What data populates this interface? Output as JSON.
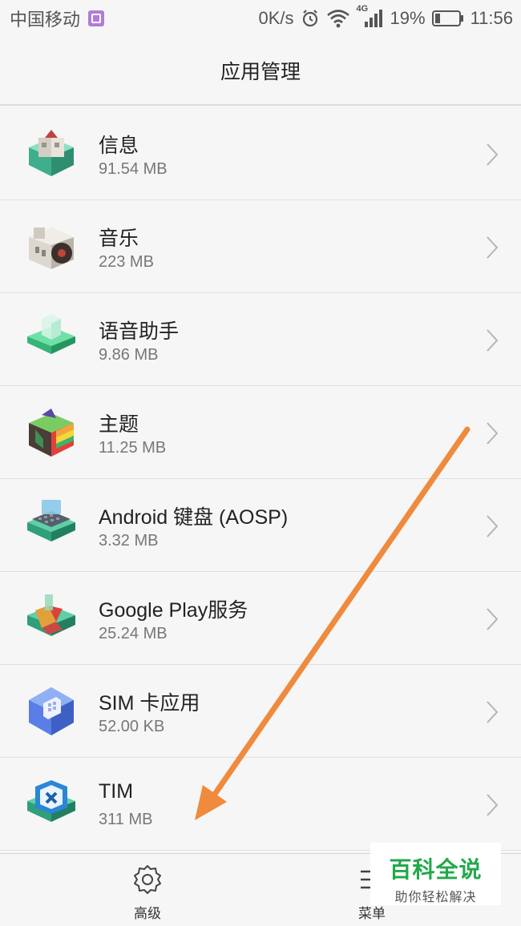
{
  "status_bar": {
    "carrier": "中国移动",
    "speed": "0K/s",
    "network": "4G",
    "battery": "19%",
    "time": "11:56"
  },
  "header": {
    "title": "应用管理"
  },
  "apps": [
    {
      "name": "信息",
      "size": "91.54 MB",
      "icon": "messages-icon"
    },
    {
      "name": "音乐",
      "size": "223 MB",
      "icon": "music-icon"
    },
    {
      "name": "语音助手",
      "size": "9.86 MB",
      "icon": "voice-assistant-icon"
    },
    {
      "name": "主题",
      "size": "11.25 MB",
      "icon": "themes-icon"
    },
    {
      "name": "Android 键盘 (AOSP)",
      "size": "3.32 MB",
      "icon": "keyboard-icon"
    },
    {
      "name": "Google Play服务",
      "size": "25.24 MB",
      "icon": "google-play-services-icon"
    },
    {
      "name": "SIM 卡应用",
      "size": "52.00 KB",
      "icon": "sim-card-icon"
    },
    {
      "name": "TIM",
      "size": "311 MB",
      "icon": "tim-icon"
    }
  ],
  "bottom_bar": {
    "advanced_label": "高级",
    "menu_label": "菜单"
  },
  "watermark": {
    "title": "百科全说",
    "subtitle": "助你轻松解决"
  },
  "colors": {
    "annotation_arrow": "#f08a3c",
    "watermark_green": "#22a84a"
  }
}
